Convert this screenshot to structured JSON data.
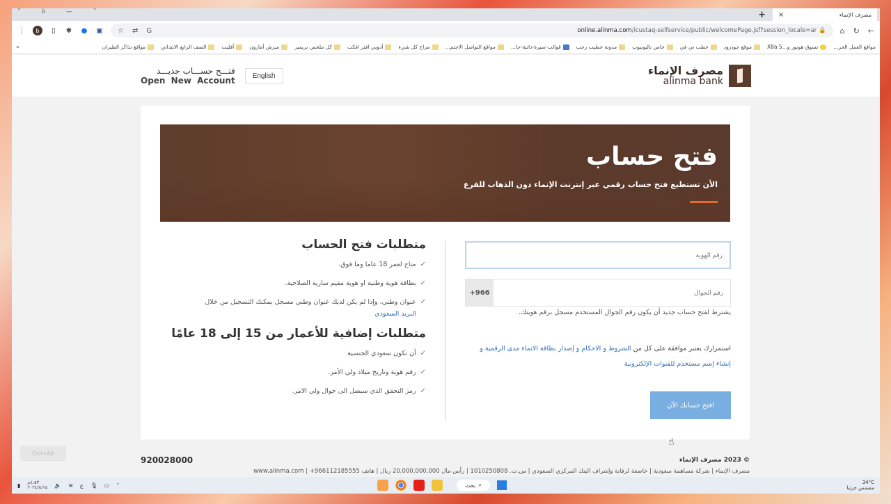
{
  "browser": {
    "tab_title": "مصرف الإنماء",
    "tab_close": "×",
    "new_tab": "+",
    "window_controls": [
      "˄",
      "ò",
      "—",
      "˅"
    ],
    "profile_initial": "b",
    "url_host": "online.alinma.com",
    "url_path": "/icustaq-selfservice/public/welcomePage.jsf?session_locale=ar",
    "bookmarks": [
      "مواقع العمل الحر...",
      "تسوق هونور و...5 X8a",
      "موقع جودرود",
      "خطب تي في",
      "خاص باليوتيوب",
      "مدونة خطيب رجب",
      "قوالب-سيرة-ذاتية-حا...",
      "مواقع التواصل الاجتم...",
      "مراح كل شيء",
      "أدوبي افتر افكت",
      "كل ملخص بريمير",
      "ميرش أمازون",
      "أفليت",
      "الصف الرابع الابتدائي",
      "مواقع تذاكر الطيران"
    ],
    "bookmarks_more": "«"
  },
  "header": {
    "logo_ar": "مصرف الإنماء",
    "logo_en": "alinma bank",
    "open_account_ar": "فتـــح حســـاب جديـــد",
    "open_account_en": "Open New Account",
    "language_button": "English"
  },
  "banner": {
    "title": "فتح حساب",
    "subtitle": "الأن تستطيع فتح حساب رقمي عبر إنترنت الإنماء دون الذهاب للفرع",
    "accent_color": "#e46a2f"
  },
  "form": {
    "id_placeholder": "رقم الهوية",
    "mobile_placeholder": "رقم الجوال",
    "country_code": "+966",
    "mobile_note": "يشترط لفتح حساب جديد أن يكون رقم الجوال المستخدم مسجل برقم هويتك.",
    "terms_prefix": "استمرارك يعتبر موافقة على كل من",
    "terms_link": "الشروط و الاحكام و إصدار بطاقة الانماء مدى الرقمية و إنشاء إسم مستخدم للقنوات الإلكترونية",
    "submit_label": "افتح حسابك الآن",
    "submit_color": "#78aee0"
  },
  "requirements": {
    "title": "متطلبات فتح الحساب",
    "items": [
      "متاح لعمر 18 عاما وما فوق.",
      "بطاقة هوية وطنية او هوية مقيم سارية الصلاحية.",
      "عنوان وطني، وإذا لم يكن لديك عنوان وطني مسجل يمكنك التسجيل من خلال"
    ],
    "link": "البريد السعودي",
    "additional_title": "متطلبات إضافية للأعمار من 15 إلى 18 عامًا",
    "additional_items": [
      "أن تكون سعودي الجنسية",
      "رقم هوية وتاريخ ميلاد ولي الأمر.",
      "رمز التحقق الذي سيصل الى جوال ولي الامر."
    ],
    "check_glyph": "✓"
  },
  "footer": {
    "phone": "920028000",
    "copyright": "© 2023 مصرف الإنماء",
    "legal": "مصرف الإنماء | شركة مساهمة سعودية | خاضعة لرقابة وإشراف البنك المركزي السعودي | س.ت. 1010250808 | رأس مال 20,000,000,000 ريال | هاتف 966112185555+ | www.alinma.com"
  },
  "taskbar": {
    "search_label": "بحث",
    "temperature": "34°C",
    "weather_text": "مشمس جزئيا",
    "clock_time": "٤:٥٣م",
    "clock_date": "٢٠٢٤/٨/١٥"
  },
  "overlay_button": "Ctrl+Alt"
}
